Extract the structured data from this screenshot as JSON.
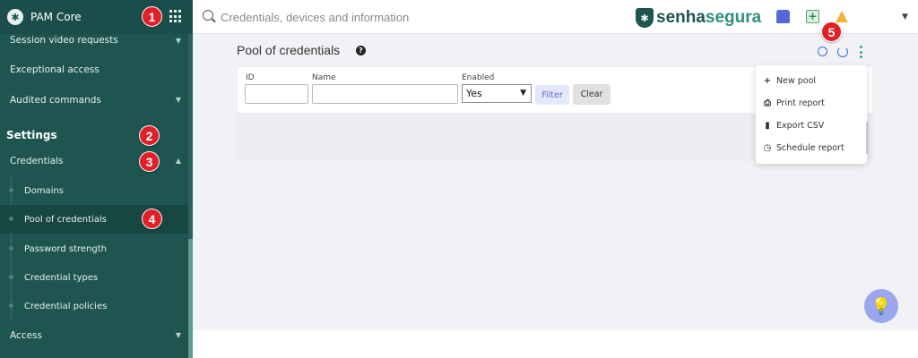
{
  "app": {
    "title": "PAM Core"
  },
  "search": {
    "placeholder": "Credentials, devices and information"
  },
  "brand": {
    "part1": "senha",
    "part2": "segura",
    "accent": "#1e5550"
  },
  "sidebar": {
    "items": [
      {
        "label": "Session video requests"
      },
      {
        "label": "Exceptional access"
      },
      {
        "label": "Audited commands"
      }
    ],
    "section": "Settings",
    "credentials_label": "Credentials",
    "sub_items": [
      {
        "label": "Domains"
      },
      {
        "label": "Pool of credentials"
      },
      {
        "label": "Password strength"
      },
      {
        "label": "Credential types"
      },
      {
        "label": "Credential policies"
      }
    ],
    "access_label": "Access"
  },
  "page": {
    "title": "Pool of credentials"
  },
  "filters": {
    "id_label": "ID",
    "name_label": "Name",
    "enabled_label": "Enabled",
    "enabled_value": "Yes",
    "filter_button": "Filter",
    "clear_button": "Clear"
  },
  "menu": {
    "items": [
      {
        "label": "New pool",
        "icon": "plus-icon"
      },
      {
        "label": "Print report",
        "icon": "print-icon"
      },
      {
        "label": "Export CSV",
        "icon": "file-icon"
      },
      {
        "label": "Schedule report",
        "icon": "clock-icon"
      }
    ]
  },
  "badges": [
    "1",
    "2",
    "3",
    "4",
    "5"
  ]
}
